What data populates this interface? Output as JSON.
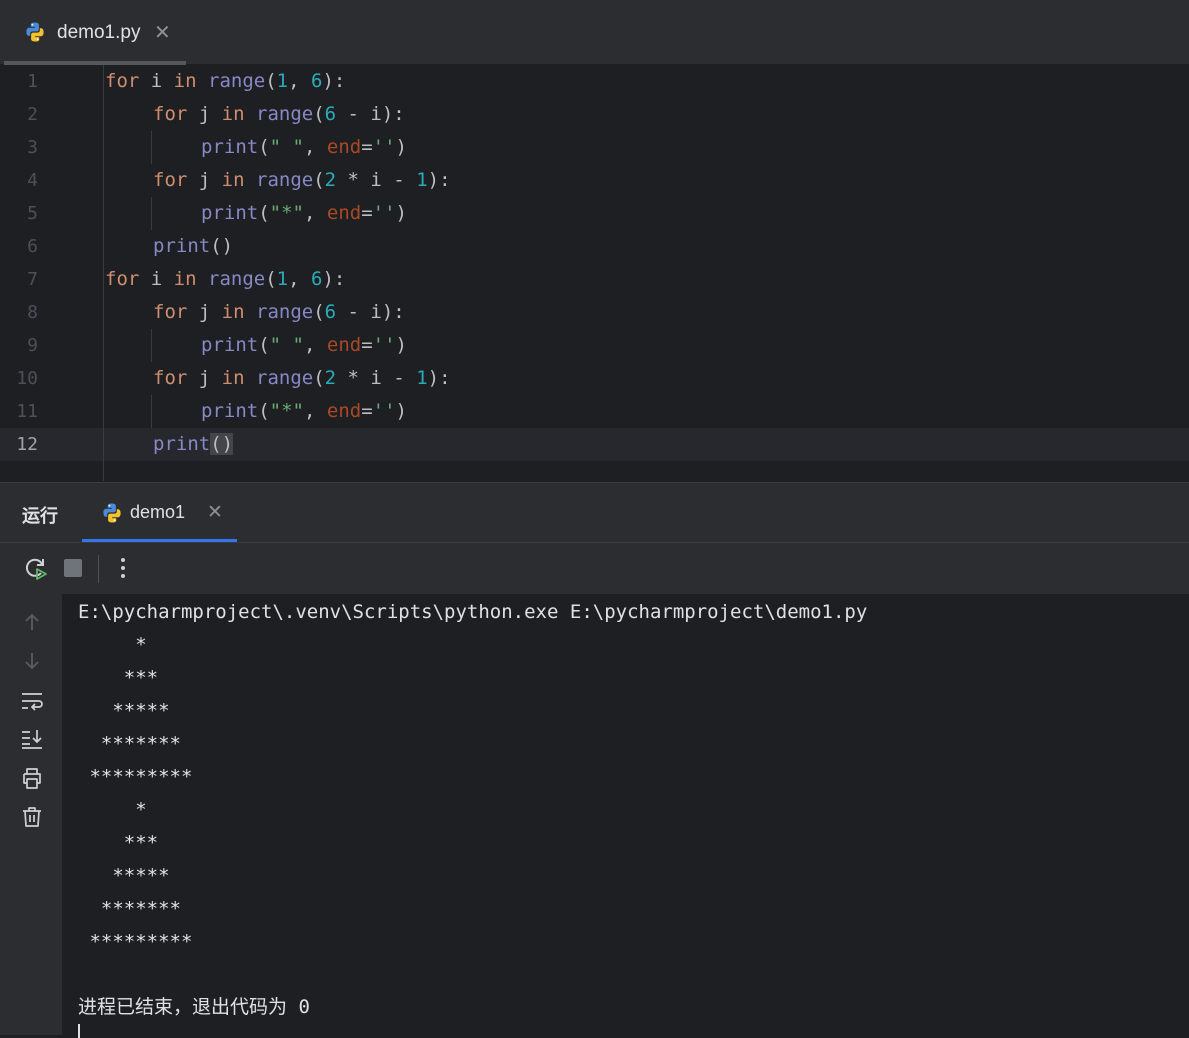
{
  "editor_tab": {
    "filename": "demo1.py"
  },
  "code_lines": [
    {
      "num": "1",
      "indent": 0,
      "tokens": [
        [
          "kw",
          "for"
        ],
        [
          "txt",
          " i "
        ],
        [
          "kw",
          "in"
        ],
        [
          "txt",
          " "
        ],
        [
          "bi",
          "range"
        ],
        [
          "txt",
          "("
        ],
        [
          "num",
          "1"
        ],
        [
          "txt",
          ", "
        ],
        [
          "num",
          "6"
        ],
        [
          "txt",
          "):"
        ]
      ]
    },
    {
      "num": "2",
      "indent": 1,
      "tokens": [
        [
          "kw",
          "for"
        ],
        [
          "txt",
          " j "
        ],
        [
          "kw",
          "in"
        ],
        [
          "txt",
          " "
        ],
        [
          "bi",
          "range"
        ],
        [
          "txt",
          "("
        ],
        [
          "num",
          "6"
        ],
        [
          "txt",
          " - i):"
        ]
      ]
    },
    {
      "num": "3",
      "indent": 2,
      "tokens": [
        [
          "bi",
          "print"
        ],
        [
          "txt",
          "("
        ],
        [
          "str",
          "\" \""
        ],
        [
          "txt",
          ", "
        ],
        [
          "par",
          "end"
        ],
        [
          "txt",
          "="
        ],
        [
          "str",
          "''"
        ],
        [
          "txt",
          ")"
        ]
      ]
    },
    {
      "num": "4",
      "indent": 1,
      "tokens": [
        [
          "kw",
          "for"
        ],
        [
          "txt",
          " j "
        ],
        [
          "kw",
          "in"
        ],
        [
          "txt",
          " "
        ],
        [
          "bi",
          "range"
        ],
        [
          "txt",
          "("
        ],
        [
          "num",
          "2"
        ],
        [
          "txt",
          " * i - "
        ],
        [
          "num",
          "1"
        ],
        [
          "txt",
          "):"
        ]
      ]
    },
    {
      "num": "5",
      "indent": 2,
      "tokens": [
        [
          "bi",
          "print"
        ],
        [
          "txt",
          "("
        ],
        [
          "str",
          "\"*\""
        ],
        [
          "txt",
          ", "
        ],
        [
          "par",
          "end"
        ],
        [
          "txt",
          "="
        ],
        [
          "str",
          "''"
        ],
        [
          "txt",
          ")"
        ]
      ]
    },
    {
      "num": "6",
      "indent": 1,
      "tokens": [
        [
          "bi",
          "print"
        ],
        [
          "txt",
          "()"
        ]
      ]
    },
    {
      "num": "7",
      "indent": 0,
      "tokens": [
        [
          "kw",
          "for"
        ],
        [
          "txt",
          " i "
        ],
        [
          "kw",
          "in"
        ],
        [
          "txt",
          " "
        ],
        [
          "bi",
          "range"
        ],
        [
          "txt",
          "("
        ],
        [
          "num",
          "1"
        ],
        [
          "txt",
          ", "
        ],
        [
          "num",
          "6"
        ],
        [
          "txt",
          "):"
        ]
      ]
    },
    {
      "num": "8",
      "indent": 1,
      "tokens": [
        [
          "kw",
          "for"
        ],
        [
          "txt",
          " j "
        ],
        [
          "kw",
          "in"
        ],
        [
          "txt",
          " "
        ],
        [
          "bi",
          "range"
        ],
        [
          "txt",
          "("
        ],
        [
          "num",
          "6"
        ],
        [
          "txt",
          " - i):"
        ]
      ]
    },
    {
      "num": "9",
      "indent": 2,
      "tokens": [
        [
          "bi",
          "print"
        ],
        [
          "txt",
          "("
        ],
        [
          "str",
          "\" \""
        ],
        [
          "txt",
          ", "
        ],
        [
          "par",
          "end"
        ],
        [
          "txt",
          "="
        ],
        [
          "str",
          "''"
        ],
        [
          "txt",
          ")"
        ]
      ]
    },
    {
      "num": "10",
      "indent": 1,
      "tokens": [
        [
          "kw",
          "for"
        ],
        [
          "txt",
          " j "
        ],
        [
          "kw",
          "in"
        ],
        [
          "txt",
          " "
        ],
        [
          "bi",
          "range"
        ],
        [
          "txt",
          "("
        ],
        [
          "num",
          "2"
        ],
        [
          "txt",
          " * i - "
        ],
        [
          "num",
          "1"
        ],
        [
          "txt",
          "):"
        ]
      ]
    },
    {
      "num": "11",
      "indent": 2,
      "tokens": [
        [
          "bi",
          "print"
        ],
        [
          "txt",
          "("
        ],
        [
          "str",
          "\"*\""
        ],
        [
          "txt",
          ", "
        ],
        [
          "par",
          "end"
        ],
        [
          "txt",
          "="
        ],
        [
          "str",
          "''"
        ],
        [
          "txt",
          ")"
        ]
      ]
    },
    {
      "num": "12",
      "indent": 1,
      "current": true,
      "tokens": [
        [
          "bi",
          "print"
        ],
        [
          "hl",
          "()"
        ]
      ]
    }
  ],
  "run_panel": {
    "title": "运行",
    "tab_label": "demo1"
  },
  "console": {
    "command": "E:\\pycharmproject\\.venv\\Scripts\\python.exe E:\\pycharmproject\\demo1.py",
    "output_lines": [
      "     *",
      "    ***",
      "   *****",
      "  *******",
      " *********",
      "     *",
      "    ***",
      "   *****",
      "  *******",
      " *********"
    ],
    "exit_message": "进程已结束，退出代码为 0"
  },
  "colors": {
    "keyword": "#cf8e6d",
    "builtin": "#8888c6",
    "number": "#2aacb8",
    "string": "#6aab73",
    "param": "#aa4926",
    "accent": "#3574f0"
  },
  "icons": {
    "rerun": "rerun-icon",
    "stop": "stop-icon",
    "more": "more-vertical-icon",
    "up": "arrow-up-icon",
    "down": "arrow-down-icon",
    "wrap": "soft-wrap-icon",
    "scroll_end": "scroll-to-end-icon",
    "print": "print-icon",
    "trash": "trash-icon"
  }
}
